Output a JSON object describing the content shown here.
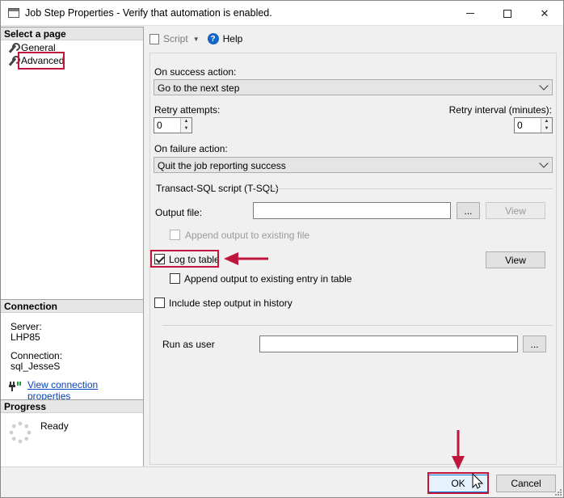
{
  "window": {
    "title": "Job Step Properties - Verify that automation is enabled.",
    "minimize_glyph": "",
    "close_glyph": "✕"
  },
  "left": {
    "select_page_header": "Select a page",
    "pages": [
      {
        "label": "General",
        "icon": "wrench-icon"
      },
      {
        "label": "Advanced",
        "icon": "wrench-icon",
        "selected": true
      }
    ],
    "connection_header": "Connection",
    "server_label": "Server:",
    "server_value": "LHP85",
    "connection_label": "Connection:",
    "connection_value": "sql_JesseS",
    "view_connection_link": "View connection properties",
    "progress_header": "Progress",
    "progress_status": "Ready"
  },
  "toolbar": {
    "script_label": "Script",
    "help_label": "Help",
    "help_glyph": "?"
  },
  "form": {
    "on_success_label": "On success action:",
    "on_success_value": "Go to the next step",
    "retry_attempts_label": "Retry attempts:",
    "retry_attempts_value": "0",
    "retry_interval_label": "Retry interval (minutes):",
    "retry_interval_value": "0",
    "on_failure_label": "On failure action:",
    "on_failure_value": "Quit the job reporting success",
    "tsql_group_label": "Transact-SQL script (T-SQL)",
    "output_file_label": "Output file:",
    "output_file_value": "",
    "browse_label": "...",
    "view_label": "View",
    "append_output_file_label": "Append output to existing file",
    "log_to_table_label": "Log to table",
    "log_to_table_checked": true,
    "view_table_label": "View",
    "append_entry_table_label": "Append output to existing entry in table",
    "append_entry_table_checked": false,
    "include_history_label": "Include step output in history",
    "include_history_checked": false,
    "run_as_user_label": "Run as user",
    "run_as_user_value": "",
    "run_as_browse_label": "..."
  },
  "footer": {
    "ok_label": "OK",
    "cancel_label": "Cancel"
  },
  "colors": {
    "highlight": "#c0163d",
    "link": "#0a44b8",
    "accent": "#0078d7"
  }
}
